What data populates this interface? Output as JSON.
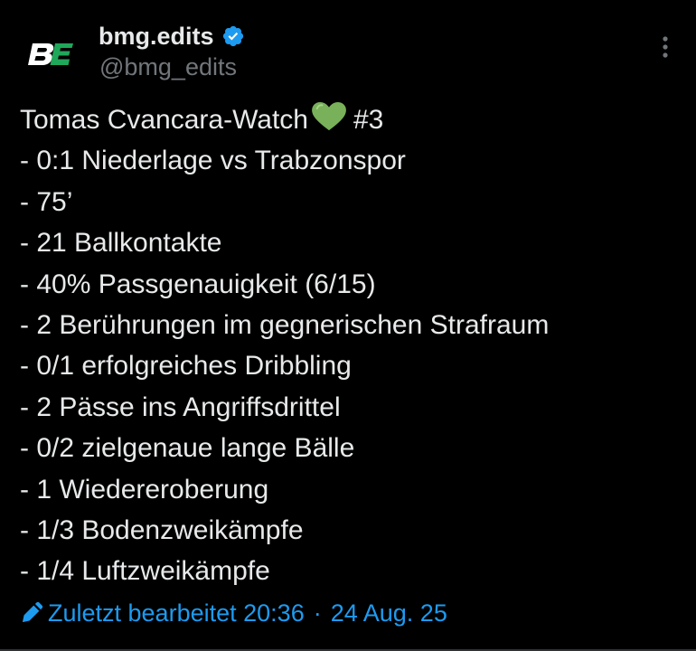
{
  "author": {
    "display_name": "bmg.edits",
    "handle": "@bmg_edits",
    "avatar_logo": "BE",
    "verified": true
  },
  "tweet": {
    "title_line_text": "Tomas Cvancara-Watch",
    "title_line_suffix": "#3",
    "lines": [
      "- 0:1 Niederlage vs Trabzonspor",
      "- 75’",
      "- 21 Ballkontakte",
      "- 40% Passgenauigkeit (6/15)",
      "- 2 Berührungen im gegnerischen Strafraum",
      "- 0/1 erfolgreiches Dribbling",
      "- 2 Pässe ins Angriffsdrittel",
      "- 0/2 zielgenaue lange Bälle",
      "- 1 Wiedereroberung",
      "- 1/3 Bodenzweikämpfe",
      "- 1/4 Luftzweikämpfe"
    ]
  },
  "edited": {
    "label": "Zuletzt bearbeitet",
    "time": "20:36",
    "separator": "·",
    "date": "24 Aug. 25"
  },
  "icons": {
    "verified": "verified-badge-icon",
    "more": "more-vertical-icon",
    "heart": "green-heart-emoji",
    "edit": "pencil-icon"
  },
  "colors": {
    "background": "#000000",
    "text": "#e7e9ea",
    "secondary_text": "#71767b",
    "accent": "#1d9bf0",
    "logo_green": "#1fa85a"
  }
}
